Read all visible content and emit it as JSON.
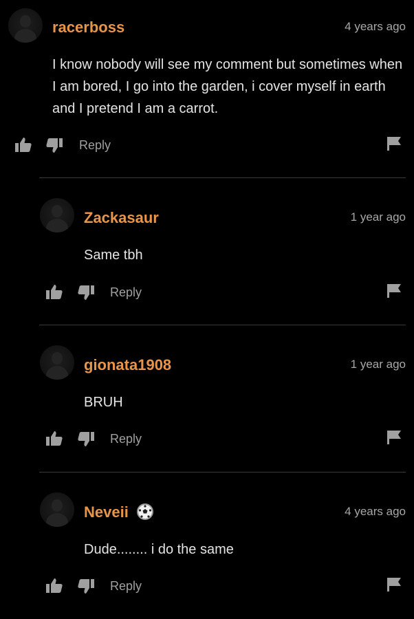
{
  "comments": [
    {
      "username": "racerboss",
      "time": "4 years ago",
      "text": "I know nobody will see my comment but sometimes when I am bored, I go into the garden, i cover myself in earth and I pretend I am a carrot.",
      "reply_label": "Reply"
    },
    {
      "username": "Zackasaur",
      "time": "1 year ago",
      "text": "Same tbh",
      "reply_label": "Reply"
    },
    {
      "username": "gionata1908",
      "time": "1 year ago",
      "text": "BRUH",
      "reply_label": "Reply"
    },
    {
      "username": "Neveii",
      "time": "4 years ago",
      "text": "Dude........ i do the same",
      "reply_label": "Reply",
      "badge_icon": "soccer-ball-icon"
    }
  ],
  "colors": {
    "background": "#000000",
    "username": "#e8954a",
    "text": "#e4e4e4",
    "muted": "#a0a0a0",
    "divider": "#3a3a3a"
  }
}
